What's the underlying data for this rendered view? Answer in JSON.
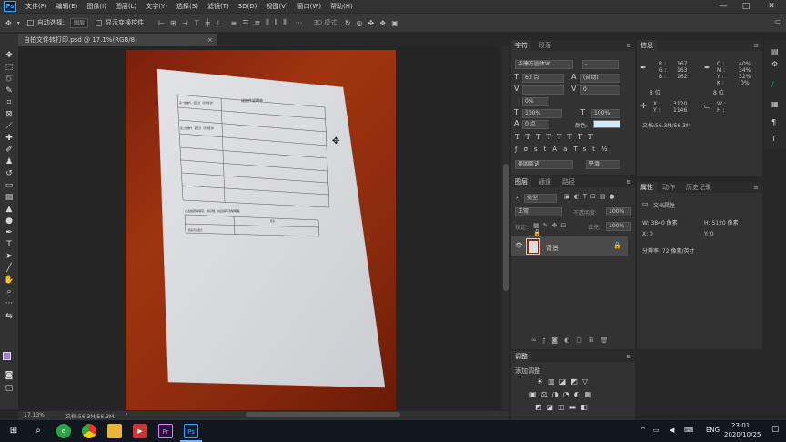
{
  "app": {
    "logo": "Ps"
  },
  "menu": [
    "文件(F)",
    "编辑(E)",
    "图像(I)",
    "图层(L)",
    "文字(Y)",
    "选择(S)",
    "滤镜(T)",
    "3D(D)",
    "视图(V)",
    "窗口(W)",
    "帮助(H)"
  ],
  "window_controls": {
    "minimize": "—",
    "maximize": "□",
    "close": "✕"
  },
  "options": {
    "auto_select_label": "自动选择:",
    "auto_select_value": "图层",
    "show_transform_label": "显示变换控件",
    "mode_3d_label": "3D 模式:"
  },
  "document": {
    "tab_title": "自拍文件转打印.psd @ 17.1%(RGB/8)",
    "tab_close": "×",
    "zoom": "17.13%",
    "doc_size": "文档:56.3M/56.3M"
  },
  "paper": {
    "title": "成物件说明单",
    "rows": [
      "第一批物件、需结合（具体批次）",
      "第二批物件、需结合（具体批次）"
    ],
    "note": "此表格若请填写、请仔细、并且填写清晰明确。",
    "footer_left": "相关签名报告",
    "footer_right": "签名"
  },
  "character_panel": {
    "tabs": [
      "字符",
      "段落"
    ],
    "font_family": "华康方圆体W...",
    "font_style": "-",
    "font_size": "60 点",
    "leading": "(自动)",
    "kerning": "",
    "tracking": "0",
    "scale_percent": "0%",
    "vertical_scale": "100%",
    "horizontal_scale": "100%",
    "baseline_shift": "0 点",
    "color_label": "颜色:",
    "color_swatch": "#cfe9ff",
    "language": "美国英语",
    "antialias": "平滑"
  },
  "info_panel": {
    "tab": "信息",
    "r_label": "R :",
    "r": "167",
    "g_label": "G :",
    "g": "163",
    "b_label": "B :",
    "b": "162",
    "c_label": "C :",
    "c": "40%",
    "m_label": "M :",
    "m": "34%",
    "y_label": "Y :",
    "y": "32%",
    "k_label": "K :",
    "k": "0%",
    "bit_left": "8 位",
    "bit_right": "8 位",
    "x_label": "X :",
    "x": "3120",
    "y2_label": "Y :",
    "y2": "1146",
    "w_label": "W :",
    "w": "",
    "h_label": "H :",
    "h": "",
    "doc": "文档:56.3M/56.3M"
  },
  "properties_panel": {
    "tabs": [
      "属性",
      "动作",
      "历史记录"
    ],
    "doc_props": "文档属性",
    "w": "W: 3840 像素",
    "h": "H: 5120 像素",
    "x": "X: 0",
    "y": "Y: 0",
    "resolution": "分辨率: 72 像素/英寸"
  },
  "layers_panel": {
    "tabs": [
      "图层",
      "通道",
      "路径"
    ],
    "filter_kind": "类型",
    "blend_mode": "正常",
    "opacity_label": "不透明度:",
    "opacity": "100%",
    "lock_label": "锁定:",
    "fill_label": "填充:",
    "fill": "100%",
    "layer_name": "背景"
  },
  "adjustments_panel": {
    "tab": "调整",
    "title": "添加调整"
  },
  "taskbar": {
    "tray_lang": "ENG",
    "time": "23:01",
    "date": "2020/10/25"
  }
}
